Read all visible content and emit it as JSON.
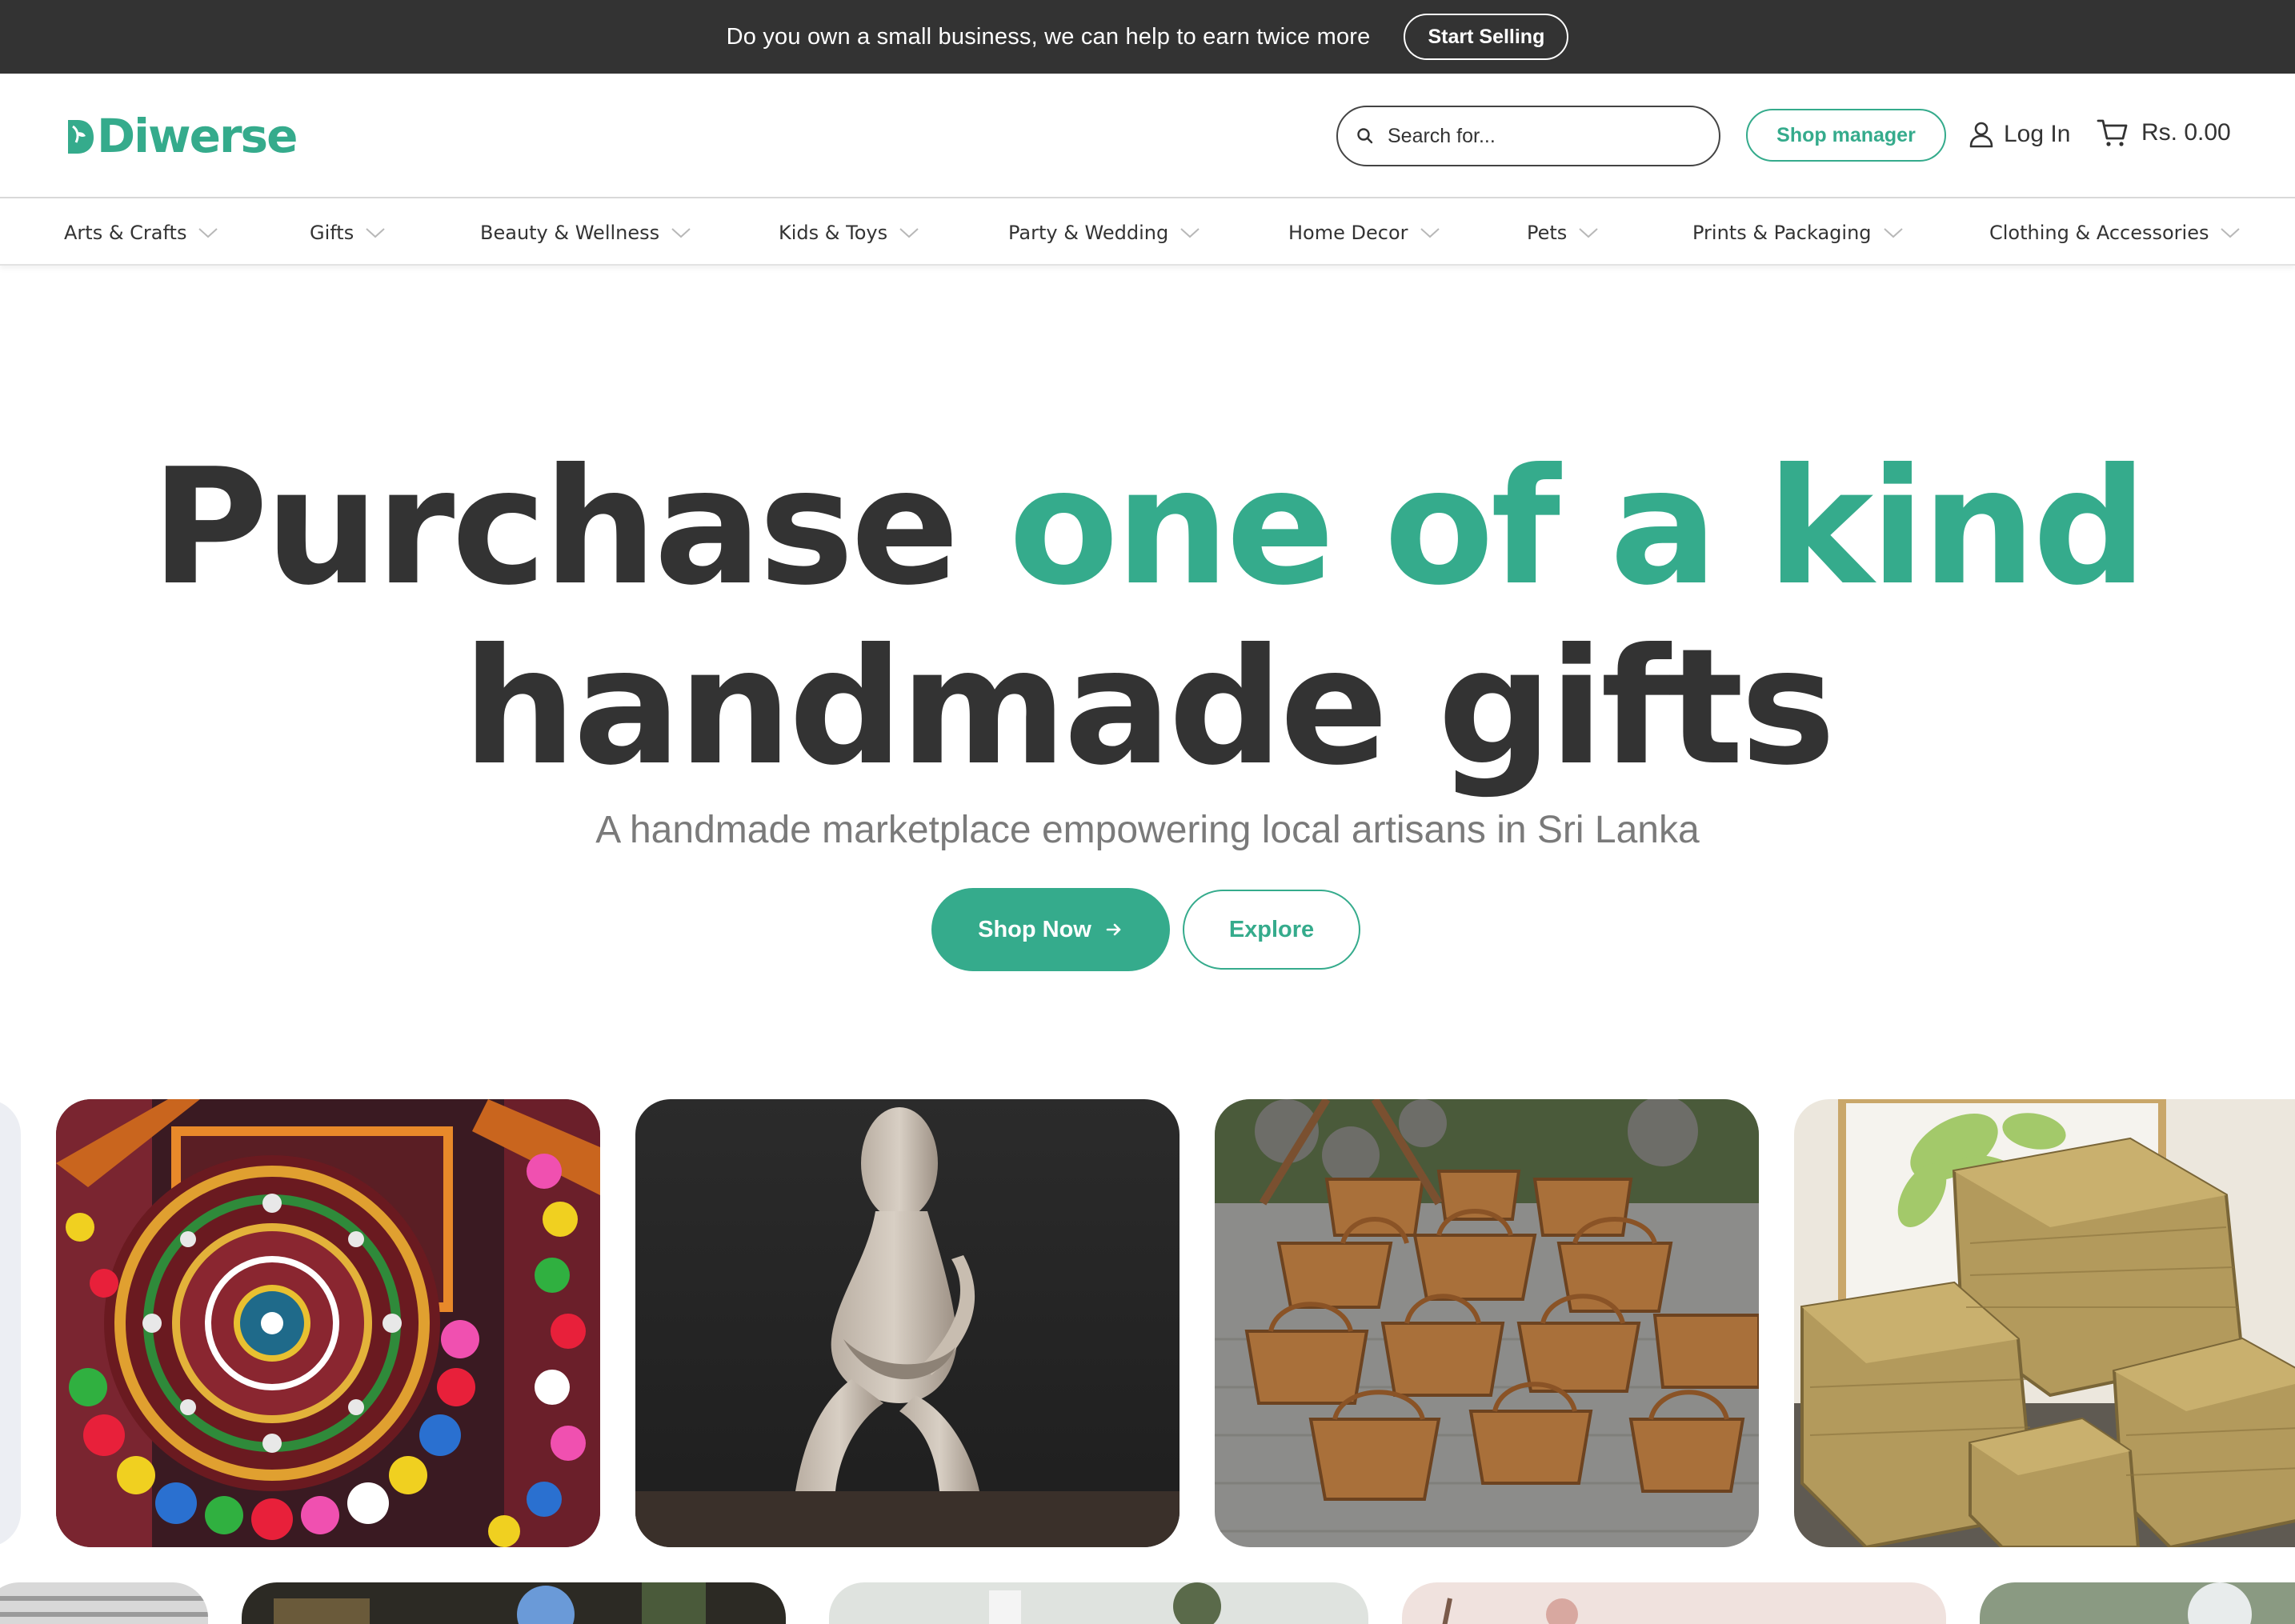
{
  "promo": {
    "text": "Do you own a small business, we can help to earn twice more",
    "button": "Start Selling"
  },
  "header": {
    "logo": "Diwerse",
    "search_placeholder": "Search for...",
    "shop_manager": "Shop manager",
    "login": "Log In",
    "cart_total": "Rs. 0.00"
  },
  "categories": [
    "Arts & Crafts",
    "Gifts",
    "Beauty & Wellness",
    "Kids & Toys",
    "Party & Wedding",
    "Home Decor",
    "Pets",
    "Prints & Packaging",
    "Clothing & Accessories"
  ],
  "hero": {
    "title_part1": "Purchase ",
    "title_accent": "one of a kind",
    "title_line2": "handmade gifts",
    "subtitle": "A handmade marketplace empowering local artisans in Sri Lanka",
    "primary_button": "Shop Now",
    "secondary_button": "Explore"
  },
  "colors": {
    "brand": "#35ab8c",
    "dark": "#333333",
    "promo_bg": "#333333",
    "muted_text": "#7a7a7a"
  },
  "gallery": {
    "items": [
      "embroidered-mirror-bag-image",
      "thinker-sculpture-image",
      "wicker-baskets-image",
      "woven-storage-boxes-image"
    ]
  }
}
